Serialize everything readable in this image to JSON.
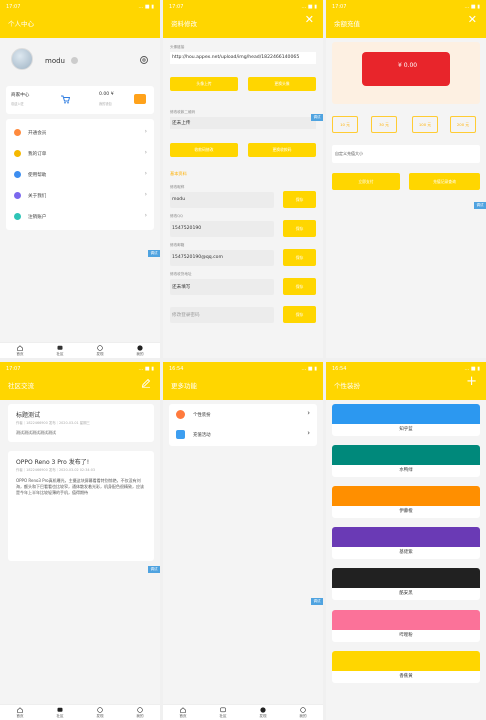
{
  "status_time_a": "17:07",
  "status_time_b": "16:54",
  "sys_icons": "… ■ ▮",
  "nav": {
    "home": "首页",
    "community": "社区",
    "discover": "发现",
    "mine": "我的"
  },
  "side_tag": "调试",
  "p1": {
    "title": "个人中心",
    "name": "modu",
    "merchant_title": "商家中心",
    "merchant_sub": "欢迎入驻",
    "amount": "0.00 ¥",
    "amount_sub": "我的钱包",
    "menu": [
      {
        "label": "开通会员",
        "color": "#ff8a3d"
      },
      {
        "label": "我的订单",
        "color": "#f5b800"
      },
      {
        "label": "使用帮助",
        "color": "#3d8ef0"
      },
      {
        "label": "关于我们",
        "color": "#7b68ee"
      },
      {
        "label": "注销账户",
        "color": "#2ec4b6"
      }
    ]
  },
  "p2": {
    "title": "资料修改",
    "avatar_label": "头像链接",
    "avatar_url": "http://hou.appex.net/upload/img/head/1822466140065",
    "btn_avatar_upload": "头像上传",
    "btn_avatar_change": "更换头像",
    "qr_label": "修改收款二维码",
    "qr_value": "还未上传",
    "btn_qr_a": "收款码修改",
    "btn_qr_b": "更换收款码",
    "section": "基本资料",
    "fields": [
      {
        "label": "修改昵称",
        "value": "modu",
        "btn": "保存"
      },
      {
        "label": "修改QQ",
        "value": "1547520190",
        "btn": "保存"
      },
      {
        "label": "修改邮箱",
        "value": "1547520190@qq.com",
        "btn": "保存"
      },
      {
        "label": "修改收货地址",
        "value": "还未填写",
        "btn": "保存"
      }
    ],
    "password_placeholder": "修改登录密码",
    "password_btn": "保存"
  },
  "p3": {
    "title": "余额充值",
    "balance": "¥ 0.00",
    "amounts": [
      "10 元",
      "30 元",
      "100 元",
      "200 元"
    ],
    "custom_label": "自定义充值大小",
    "btn_pay": "立即支付",
    "btn_record": "充值记录查询"
  },
  "p4": {
    "title": "社区交流",
    "posts": [
      {
        "title": "标题测试",
        "meta": "作者｜1822466900 发布｜2020-03-01 星期三",
        "body": "测试测试测试测试测试"
      },
      {
        "title": "OPPO Reno 3 Pro 发布了!",
        "meta": "作者｜1822466900 发布｜2020-03-02 02:34:03",
        "body": "OPPO Reno3 Pro真机曝光，主摄这块屏幕看看特别惊艳，不仅没有刘海，额头和下巴看看也比较窄，通体散发着光彩，机身配色很精致，应该是今年上半年比较轻薄的手机，值得期待"
      }
    ]
  },
  "p5": {
    "title": "更多功能",
    "items": [
      {
        "label": "个性装扮",
        "color": "#ff7a3d"
      },
      {
        "label": "充值活动",
        "color": "#3d9ef0"
      }
    ]
  },
  "p6": {
    "title": "个性装扮",
    "themes": [
      {
        "label": "知乎蓝",
        "color": "#2c98f0"
      },
      {
        "label": "水鸭绿",
        "color": "#00897b"
      },
      {
        "label": "伊藤橙",
        "color": "#ff8f00"
      },
      {
        "label": "基佬紫",
        "color": "#6a3ab5"
      },
      {
        "label": "酷安黑",
        "color": "#212121"
      },
      {
        "label": "哔哩粉",
        "color": "#fb7299"
      },
      {
        "label": "香蕉黄",
        "color": "#ffd600"
      }
    ]
  }
}
